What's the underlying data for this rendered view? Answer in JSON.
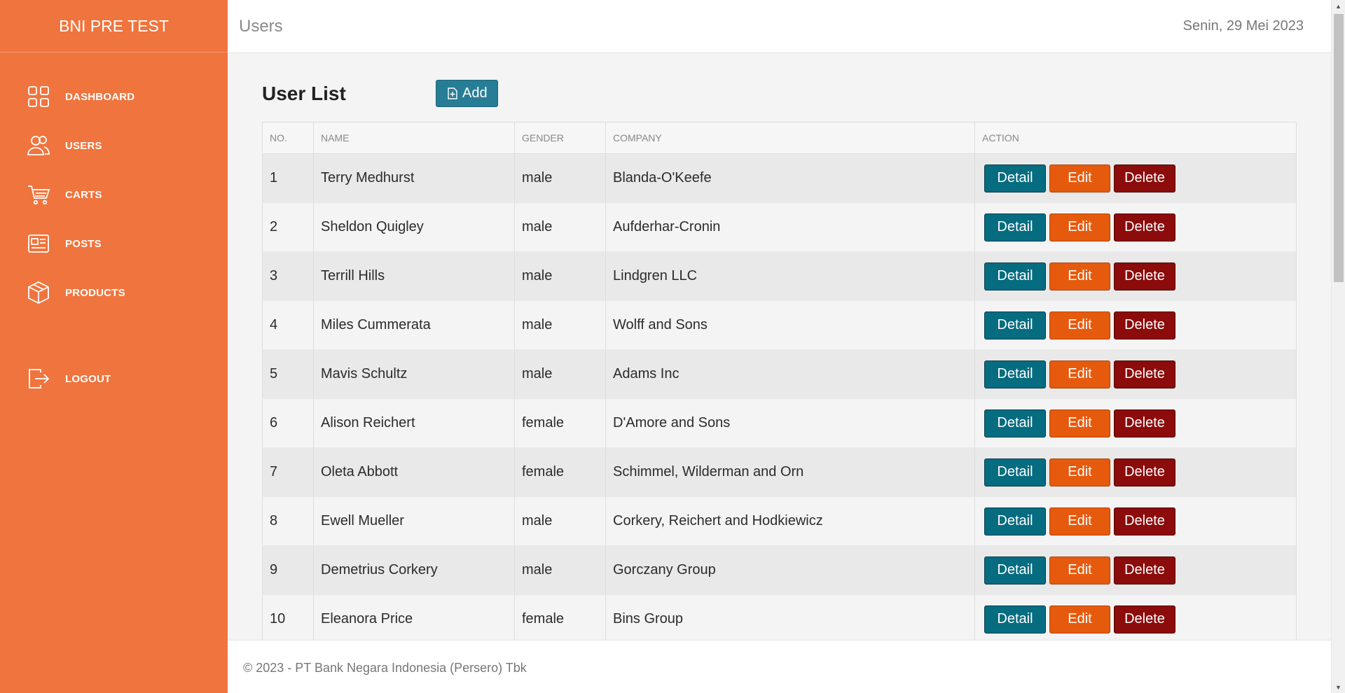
{
  "brand": "BNI PRE TEST",
  "nav": [
    {
      "label": "DASHBOARD",
      "icon": "dashboard-grid-icon"
    },
    {
      "label": "USERS",
      "icon": "users-icon"
    },
    {
      "label": "CARTS",
      "icon": "cart-icon"
    },
    {
      "label": "POSTS",
      "icon": "newspaper-icon"
    },
    {
      "label": "PRODUCTS",
      "icon": "box-icon"
    }
  ],
  "logout": {
    "label": "LOGOUT",
    "icon": "logout-icon"
  },
  "header": {
    "title": "Users",
    "date": "Senin, 29 Mei 2023"
  },
  "main": {
    "title": "User List",
    "add_label": "Add",
    "columns": [
      "NO.",
      "NAME",
      "GENDER",
      "COMPANY",
      "ACTION"
    ],
    "rows": [
      {
        "no": "1",
        "name": "Terry Medhurst",
        "gender": "male",
        "company": "Blanda-O'Keefe"
      },
      {
        "no": "2",
        "name": "Sheldon Quigley",
        "gender": "male",
        "company": "Aufderhar-Cronin"
      },
      {
        "no": "3",
        "name": "Terrill Hills",
        "gender": "male",
        "company": "Lindgren LLC"
      },
      {
        "no": "4",
        "name": "Miles Cummerata",
        "gender": "male",
        "company": "Wolff and Sons"
      },
      {
        "no": "5",
        "name": "Mavis Schultz",
        "gender": "male",
        "company": "Adams Inc"
      },
      {
        "no": "6",
        "name": "Alison Reichert",
        "gender": "female",
        "company": "D'Amore and Sons"
      },
      {
        "no": "7",
        "name": "Oleta Abbott",
        "gender": "female",
        "company": "Schimmel, Wilderman and Orn"
      },
      {
        "no": "8",
        "name": "Ewell Mueller",
        "gender": "male",
        "company": "Corkery, Reichert and Hodkiewicz"
      },
      {
        "no": "9",
        "name": "Demetrius Corkery",
        "gender": "male",
        "company": "Gorczany Group"
      },
      {
        "no": "10",
        "name": "Eleanora Price",
        "gender": "female",
        "company": "Bins Group"
      }
    ],
    "actions": {
      "detail": "Detail",
      "edit": "Edit",
      "delete": "Delete"
    }
  },
  "footer": {
    "text": "© 2023 - PT Bank Negara Indonesia (Persero) Tbk"
  },
  "colors": {
    "sidebar": "#f0743d",
    "detail": "#066c80",
    "edit": "#e65a0e",
    "delete": "#8c0b0b",
    "add": "#277d95"
  }
}
